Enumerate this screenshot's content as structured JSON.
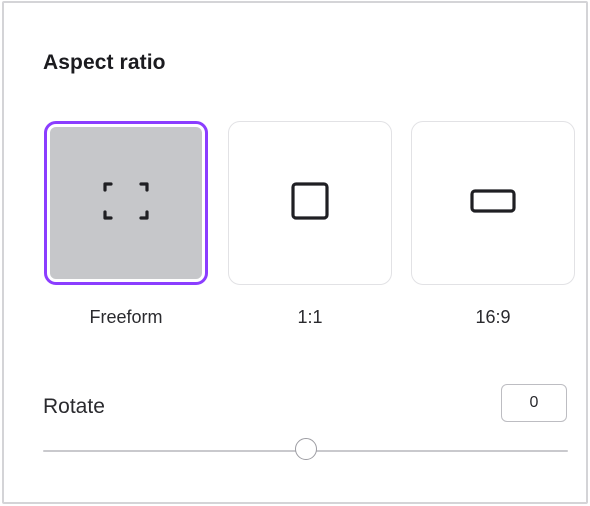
{
  "panel": {
    "title": "Aspect ratio"
  },
  "aspect_options": [
    {
      "label": "Freeform",
      "icon": "freeform-crop-icon",
      "selected": true
    },
    {
      "label": "1:1",
      "icon": "square-icon",
      "selected": false
    },
    {
      "label": "16:9",
      "icon": "widescreen-rectangle-icon",
      "selected": false
    }
  ],
  "rotate": {
    "label": "Rotate",
    "value": "0",
    "slider_fraction": 0.5
  },
  "colors": {
    "accent": "#8b3dff",
    "selected_fill": "#c6c7ca",
    "icon_stroke": "#1f1f23"
  }
}
